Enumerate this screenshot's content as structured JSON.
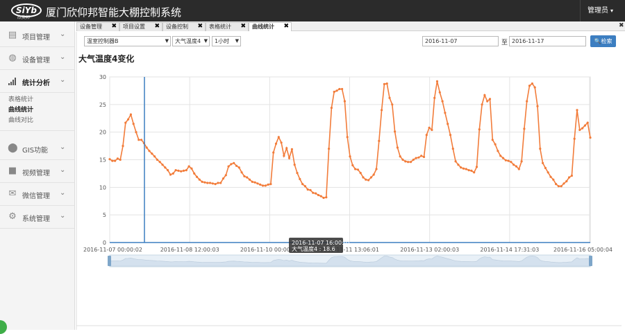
{
  "brand": {
    "logo_text": "SiYb",
    "logo_sub": "欣奕邦",
    "title": "厦门欣仰邦智能大棚控制系统"
  },
  "header": {
    "user_label": "管理员",
    "user_caret": "▾"
  },
  "sidebar": {
    "items": [
      {
        "label": "项目管理",
        "icon": "grid-icon"
      },
      {
        "label": "设备管理",
        "icon": "globe-icon"
      },
      {
        "label": "统计分析",
        "icon": "signal-icon",
        "active": true
      },
      {
        "label": "GIS功能",
        "icon": "map-marker-icon"
      },
      {
        "label": "视频管理",
        "icon": "video-camera-icon"
      },
      {
        "label": "微信管理",
        "icon": "envelope-icon"
      },
      {
        "label": "系统管理",
        "icon": "gear-icon"
      }
    ],
    "sub_items": [
      "表格统计",
      "曲线统计",
      "曲线对比"
    ],
    "chevron": "⌄"
  },
  "tabs": [
    {
      "label": "设备管理"
    },
    {
      "label": "项目设置"
    },
    {
      "label": "设备控制"
    },
    {
      "label": "表格统计"
    },
    {
      "label": "曲线统计",
      "active": true
    }
  ],
  "tab_close": "✖",
  "filters": {
    "controller": "温室控制器B",
    "sensor": "大气温度4",
    "interval": "1小时",
    "date_from": "2016-11-07",
    "to_label": "至",
    "date_to": "2016-11-17",
    "search_label": "检索"
  },
  "chart_title": "大气温度4变化",
  "tooltip": {
    "line1": "2016-11-07 16:00:01",
    "line2": "大气温度4 : 18.6"
  },
  "colors": {
    "line": "#f27c3a",
    "accent": "#3c7ec1",
    "topbar": "#2b2b2b"
  },
  "chart_data": {
    "type": "line",
    "title": "大气温度4变化",
    "ylim": [
      0,
      30
    ],
    "y_ticks": [
      0,
      5,
      10,
      15,
      20,
      25,
      30
    ],
    "x_tick_labels": [
      "2016-11-07 00:00:02",
      "2016-11-08 12:00:03",
      "2016-11-10 00:00:04",
      "2016-11-11 13:06:01",
      "2016-11-13 02:00:03",
      "2016-11-14 17:31:03",
      "2016-11-16 05:00:04"
    ],
    "grid": true,
    "series": [
      {
        "name": "大气温度4",
        "values": [
          15.1,
          14.8,
          14.8,
          15.2,
          15.0,
          17.5,
          21.7,
          22.3,
          23.2,
          21.5,
          20.0,
          18.6,
          18.6,
          18.0,
          17.2,
          16.6,
          16.1,
          15.6,
          15.0,
          14.6,
          14.1,
          13.6,
          13.1,
          12.3,
          12.5,
          13.1,
          13.0,
          12.9,
          13.0,
          13.1,
          13.8,
          13.4,
          12.5,
          11.9,
          11.4,
          11.0,
          10.9,
          10.8,
          10.8,
          10.7,
          10.6,
          10.8,
          10.8,
          11.6,
          12.2,
          13.8,
          14.2,
          14.4,
          13.9,
          13.6,
          12.7,
          12.0,
          11.8,
          11.4,
          11.0,
          10.9,
          10.7,
          10.5,
          10.3,
          10.3,
          10.5,
          10.6,
          16.3,
          17.9,
          19.1,
          18.1,
          15.7,
          17.1,
          15.3,
          16.9,
          14.1,
          12.6,
          11.5,
          10.6,
          10.2,
          9.6,
          9.5,
          9.0,
          8.9,
          8.6,
          8.4,
          8.1,
          8.2,
          17.0,
          24.4,
          27.3,
          27.5,
          27.8,
          27.8,
          25.6,
          19.1,
          15.6,
          14.0,
          13.3,
          13.2,
          12.6,
          11.8,
          11.4,
          11.3,
          11.8,
          12.3,
          13.3,
          18.4,
          24.0,
          28.7,
          28.8,
          26.2,
          25.0,
          20.1,
          17.2,
          15.6,
          15.0,
          14.7,
          14.6,
          14.6,
          15.0,
          15.3,
          15.4,
          15.7,
          15.5,
          19.5,
          20.8,
          20.4,
          26.2,
          29.2,
          27.2,
          25.6,
          23.5,
          21.5,
          19.5,
          17.0,
          14.7,
          14.1,
          13.6,
          13.4,
          13.3,
          13.1,
          13.0,
          12.7,
          13.7,
          20.5,
          25.0,
          26.7,
          25.6,
          26.0,
          18.6,
          17.8,
          16.6,
          15.7,
          15.3,
          14.9,
          14.8,
          14.6,
          14.1,
          13.8,
          13.3,
          14.7,
          20.6,
          25.6,
          28.4,
          28.8,
          28.1,
          24.7,
          17.0,
          14.4,
          13.5,
          12.7,
          11.9,
          11.4,
          10.6,
          10.2,
          10.2,
          10.7,
          11.1,
          11.8,
          12.1,
          18.8,
          24.0,
          20.4,
          20.7,
          21.2,
          21.7,
          19.0
        ]
      }
    ]
  }
}
